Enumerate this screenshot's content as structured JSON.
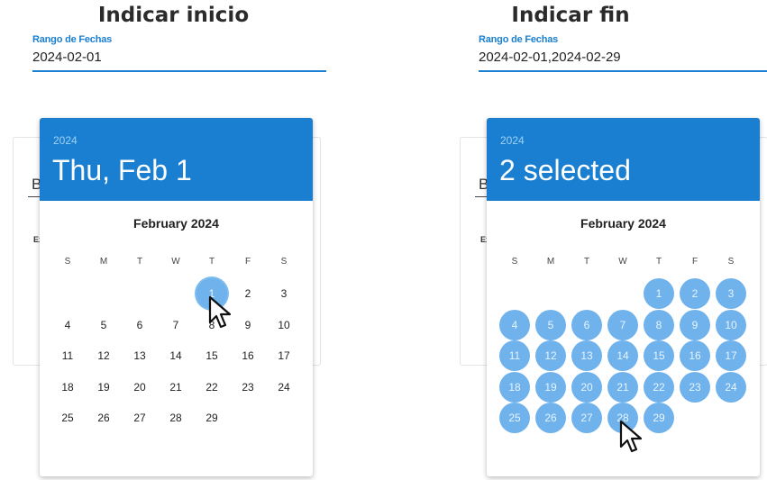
{
  "panels": [
    {
      "heading": "Indicar inicio",
      "field": {
        "label": "Rango de Fechas",
        "value": "2024-02-01"
      },
      "background": {
        "letter": "B",
        "small_text": "Ex"
      },
      "picker": {
        "year": "2024",
        "header_text": "Thu, Feb 1",
        "month": "February 2024",
        "weekdays": [
          "S",
          "M",
          "T",
          "W",
          "T",
          "F",
          "S"
        ],
        "first_weekday_index": 4,
        "days": [
          "1",
          "2",
          "3",
          "4",
          "5",
          "6",
          "7",
          "8",
          "9",
          "10",
          "11",
          "12",
          "13",
          "14",
          "15",
          "16",
          "17",
          "18",
          "19",
          "20",
          "21",
          "22",
          "23",
          "24",
          "25",
          "26",
          "27",
          "28",
          "29"
        ],
        "selected": [
          "1"
        ],
        "cursor_over_day": "1"
      }
    },
    {
      "heading": "Indicar fin",
      "field": {
        "label": "Rango de Fechas",
        "value": "2024-02-01,2024-02-29"
      },
      "background": {
        "letter": "B",
        "small_text": "Ex"
      },
      "picker": {
        "year": "2024",
        "header_text": "2 selected",
        "month": "February 2024",
        "weekdays": [
          "S",
          "M",
          "T",
          "W",
          "T",
          "F",
          "S"
        ],
        "first_weekday_index": 4,
        "days": [
          "1",
          "2",
          "3",
          "4",
          "5",
          "6",
          "7",
          "8",
          "9",
          "10",
          "11",
          "12",
          "13",
          "14",
          "15",
          "16",
          "17",
          "18",
          "19",
          "20",
          "21",
          "22",
          "23",
          "24",
          "25",
          "26",
          "27",
          "28",
          "29"
        ],
        "selected": [
          "1",
          "2",
          "3",
          "4",
          "5",
          "6",
          "7",
          "8",
          "9",
          "10",
          "11",
          "12",
          "13",
          "14",
          "15",
          "16",
          "17",
          "18",
          "19",
          "20",
          "21",
          "22",
          "23",
          "24",
          "25",
          "26",
          "27",
          "28",
          "29"
        ],
        "cursor_over_day": "28"
      }
    }
  ],
  "colors": {
    "accent": "#1a7fd0",
    "selected_day": "#6fb2ec",
    "header_year": "#9fd0f5"
  },
  "icons": {
    "cursor": "mouse-pointer-icon"
  }
}
